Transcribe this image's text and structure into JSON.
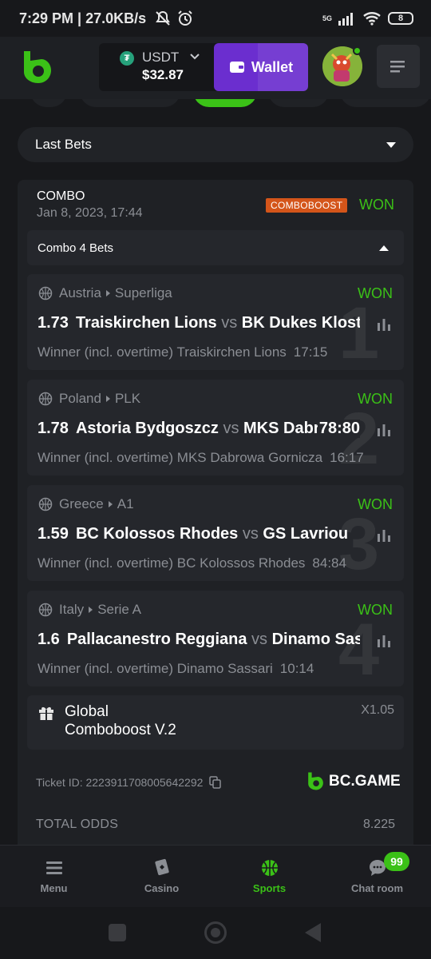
{
  "status_bar": {
    "time_speed": "7:29 PM | 27.0KB/s",
    "network": "5G",
    "battery": "8"
  },
  "header": {
    "currency": "USDT",
    "currency_icon": "tether-icon",
    "balance": "$32.87",
    "wallet_label": "Wallet"
  },
  "last_bets": {
    "label": "Last Bets"
  },
  "combo": {
    "title": "COMBO",
    "date": "Jan 8, 2023, 17:44",
    "badge": "COMBOBOOST",
    "status": "WON",
    "subheader": "Combo 4 Bets"
  },
  "bets": [
    {
      "index": "1",
      "country": "Austria",
      "league": "Superliga",
      "status": "WON",
      "odds": "1.73",
      "home": "Traiskirchen Lions",
      "vs": "vs",
      "away": "BK Dukes Klosterneuburg",
      "score": "",
      "market": "Winner (incl. overtime)",
      "selection": "Traiskirchen Lions",
      "extra": "17:15"
    },
    {
      "index": "2",
      "country": "Poland",
      "league": "PLK",
      "status": "WON",
      "odds": "1.78",
      "home": "Astoria Bydgoszcz",
      "vs": "vs",
      "away": "MKS Dabrowa Gornicza",
      "score": "78:80",
      "market": "Winner (incl. overtime)",
      "selection": "MKS Dabrowa Gornicza",
      "extra": "16:17"
    },
    {
      "index": "3",
      "country": "Greece",
      "league": "A1",
      "status": "WON",
      "odds": "1.59",
      "home": "BC Kolossos Rhodes",
      "vs": "vs",
      "away": "GS Lavriou",
      "score": "",
      "market": "Winner (incl. overtime)",
      "selection": "BC Kolossos Rhodes",
      "extra": "84:84"
    },
    {
      "index": "4",
      "country": "Italy",
      "league": "Serie A",
      "status": "WON",
      "odds": "1.6",
      "home": "Pallacanestro Reggiana",
      "vs": "vs",
      "away": "Dinamo Sassari",
      "score": "",
      "market": "Winner (incl. overtime)",
      "selection": "Dinamo Sassari",
      "extra": "10:14"
    }
  ],
  "boost": {
    "line1": "Global",
    "line2": "Comboboost V.2",
    "multiplier": "X1.05"
  },
  "ticket": {
    "label": "Ticket ID: 2223911708005642292",
    "brand": "BC.GAME"
  },
  "totals": {
    "label": "TOTAL ODDS",
    "value": "8.225"
  },
  "bottom_nav": {
    "items": [
      {
        "label": "Menu",
        "icon": "menu-icon"
      },
      {
        "label": "Casino",
        "icon": "casino-icon"
      },
      {
        "label": "Sports",
        "icon": "basketball-icon"
      },
      {
        "label": "Chat room",
        "icon": "chat-icon"
      }
    ],
    "chat_badge": "99"
  },
  "colors": {
    "accent_green": "#3bc117",
    "wallet_purple": "#6b2ecf",
    "boost_orange": "#d4551a",
    "background": "#17181b"
  }
}
